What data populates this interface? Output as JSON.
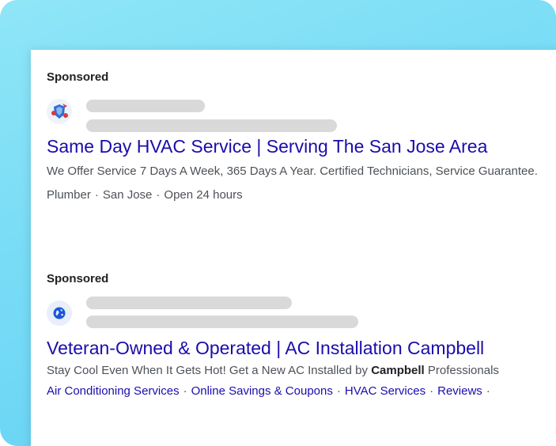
{
  "ads": [
    {
      "sponsored_label": "Sponsored",
      "favicon": "hvac-logo-icon",
      "title": "Same Day HVAC Service | Serving The San Jose Area",
      "description": "We Offer Service 7 Days A Week, 365 Days A Year. Certified Technicians, Service Guarantee.",
      "meta": [
        "Plumber",
        "San Jose",
        "Open 24 hours"
      ]
    },
    {
      "sponsored_label": "Sponsored",
      "favicon": "globe-icon",
      "title": "Veteran-Owned & Operated | AC Installation Campbell",
      "description_before": "Stay Cool Even When It Gets Hot! Get a New AC Installed by ",
      "description_bold": "Campbell",
      "description_after": " Professionals",
      "sitelinks": [
        "Air Conditioning Services",
        "Online Savings & Coupons",
        "HVAC Services",
        "Reviews"
      ],
      "sitelink_separator": "·"
    }
  ],
  "meta_separator": "·",
  "colors": {
    "link": "#1a0dab",
    "text": "#4d5156",
    "placeholder_bar": "#d9d9d9",
    "background_gradient": "#79dcf6"
  }
}
